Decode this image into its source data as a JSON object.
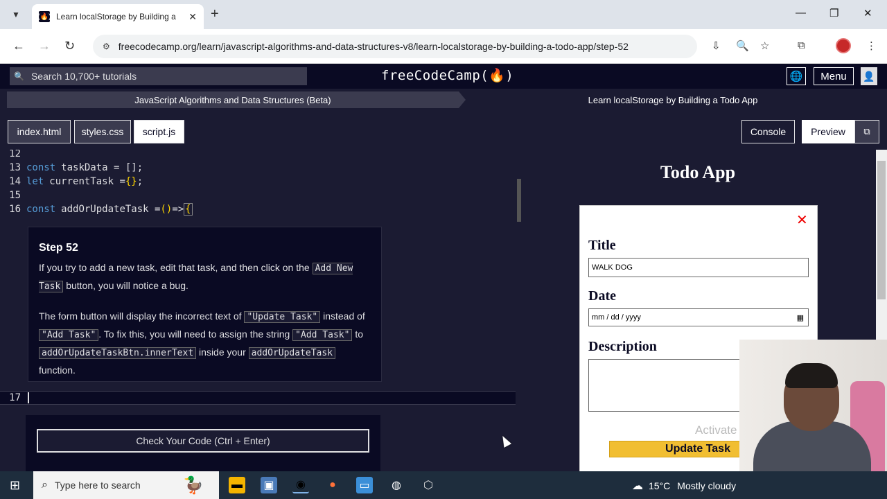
{
  "browser": {
    "tab_title": "Learn localStorage by Building a",
    "url": "freecodecamp.org/learn/javascript-algorithms-and-data-structures-v8/learn-localstorage-by-building-a-todo-app/step-52",
    "new_tab": "+",
    "close": "✕",
    "minimize": "—",
    "restore": "❐",
    "close_window": "✕"
  },
  "fcc": {
    "search_placeholder": "Search 10,700+ tutorials",
    "logo": "freeCodeCamp(🔥)",
    "menu_label": "Menu",
    "breadcrumb_course": "JavaScript Algorithms and Data Structures (Beta)",
    "breadcrumb_project": "Learn localStorage by Building a Todo App"
  },
  "editor_tabs": [
    {
      "label": "index.html",
      "active": false
    },
    {
      "label": "styles.css",
      "active": false
    },
    {
      "label": "script.js",
      "active": true
    }
  ],
  "panel_buttons": {
    "console": "Console",
    "preview": "Preview"
  },
  "code": {
    "line12": "12",
    "line13_num": "13",
    "line13_kw": "const",
    "line13_rest": "taskData = [];",
    "line14_num": "14",
    "line14_kw": "let",
    "line14_rest": "currentTask = ",
    "line14_braces": "{}",
    "line14_end": ";",
    "line15": "15",
    "line16_num": "16",
    "line16_kw": "const",
    "line16_rest": "addOrUpdateTask = ",
    "line16_parens": "()",
    "line16_arrow": " => ",
    "line16_brace": "{",
    "line17": "17"
  },
  "instructions": {
    "title": "Step 52",
    "p1_a": "If you try to add a new task, edit that task, and then click on the ",
    "p1_code": "Add New Task",
    "p1_b": " button, you will notice a bug.",
    "p2_a": "The form button will display the incorrect text of ",
    "p2_code1": "\"Update Task\"",
    "p2_b": " instead of ",
    "p2_code2": "\"Add Task\"",
    "p2_c": ". To fix this, you will need to assign the string ",
    "p2_code3": "\"Add Task\"",
    "p2_d": " to ",
    "p2_code4": "addOrUpdateTaskBtn.innerText",
    "p2_e": " inside your ",
    "p2_code5": "addOrUpdateTask",
    "p2_f": " function."
  },
  "check_button": "Check Your Code (Ctrl + Enter)",
  "preview": {
    "app_title": "Todo App",
    "close_icon": "✕",
    "title_label": "Title",
    "title_value": "WALK DOG",
    "date_label": "Date",
    "date_placeholder": "mm / dd / yyyy",
    "description_label": "Description",
    "update_button": "Update Task",
    "watermark": "Activate"
  },
  "taskbar": {
    "search_placeholder": "Type here to search",
    "temperature": "15°C",
    "weather": "Mostly cloudy"
  }
}
